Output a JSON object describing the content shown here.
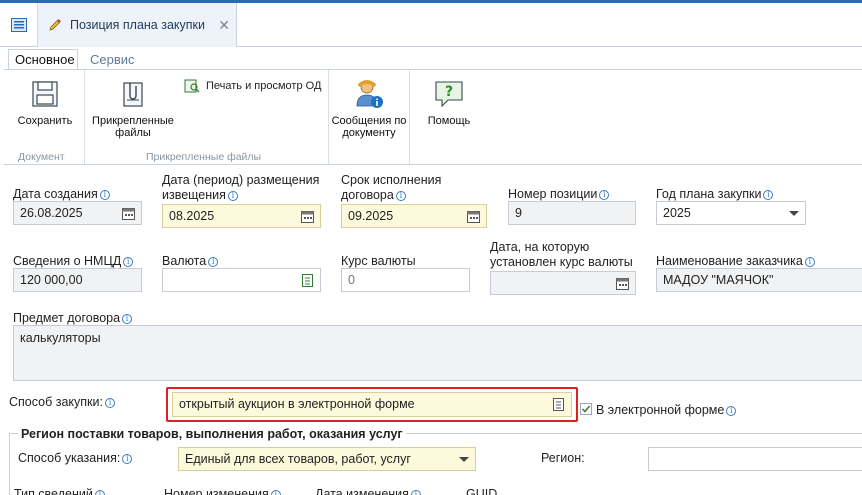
{
  "tab": {
    "title": "Позиция плана закупки",
    "close": "✕"
  },
  "ribbon": {
    "tabs": [
      "Основное",
      "Сервис"
    ],
    "buttons": {
      "save": "Сохранить",
      "attached": "Прикрепленные\nфайлы",
      "print": "Печать и просмотр ОД",
      "messages": "Сообщения по\nдокументу",
      "help": "Помощь"
    },
    "groups": {
      "document": "Документ",
      "files": "Прикрепленные файлы"
    }
  },
  "form": {
    "created": {
      "label": "Дата создания",
      "value": "26.08.2025"
    },
    "placement": {
      "label": "Дата (период) размещения\nизвещения",
      "value": "08.2025"
    },
    "term": {
      "label": "Срок исполнения\nдоговора",
      "value": "09.2025"
    },
    "position_num": {
      "label": "Номер позиции",
      "value": "9"
    },
    "plan_year": {
      "label": "Год плана закупки",
      "value": "2025"
    },
    "nmcd": {
      "label": "Сведения о НМЦД",
      "value": "120 000,00"
    },
    "currency": {
      "label": "Валюта",
      "value": ""
    },
    "rate": {
      "label": "Курс валюты",
      "value": "0"
    },
    "rate_date": {
      "label": "Дата, на которую\nустановлен курс валюты",
      "value": ""
    },
    "customer": {
      "label": "Наименование заказчика",
      "value": "МАДОУ \"МАЯЧОК\""
    },
    "subject": {
      "label": "Предмет договора",
      "value": "калькуляторы"
    },
    "method": {
      "label": "Способ закупки:",
      "value": "открытый аукцион в электронной форме"
    },
    "electronic": {
      "label": "В электронной форме",
      "checked": true
    },
    "region_section": {
      "title": "Регион поставки товаров, выполнения работ, оказания услуг"
    },
    "indication": {
      "label": "Способ указания:",
      "value": "Единый для всех товаров, работ, услуг"
    },
    "region": {
      "label": "Регион:",
      "value": ""
    },
    "bottom_labels": [
      "Тип сведений",
      "Номер изменения",
      "Дата изменения",
      "GUID"
    ]
  }
}
